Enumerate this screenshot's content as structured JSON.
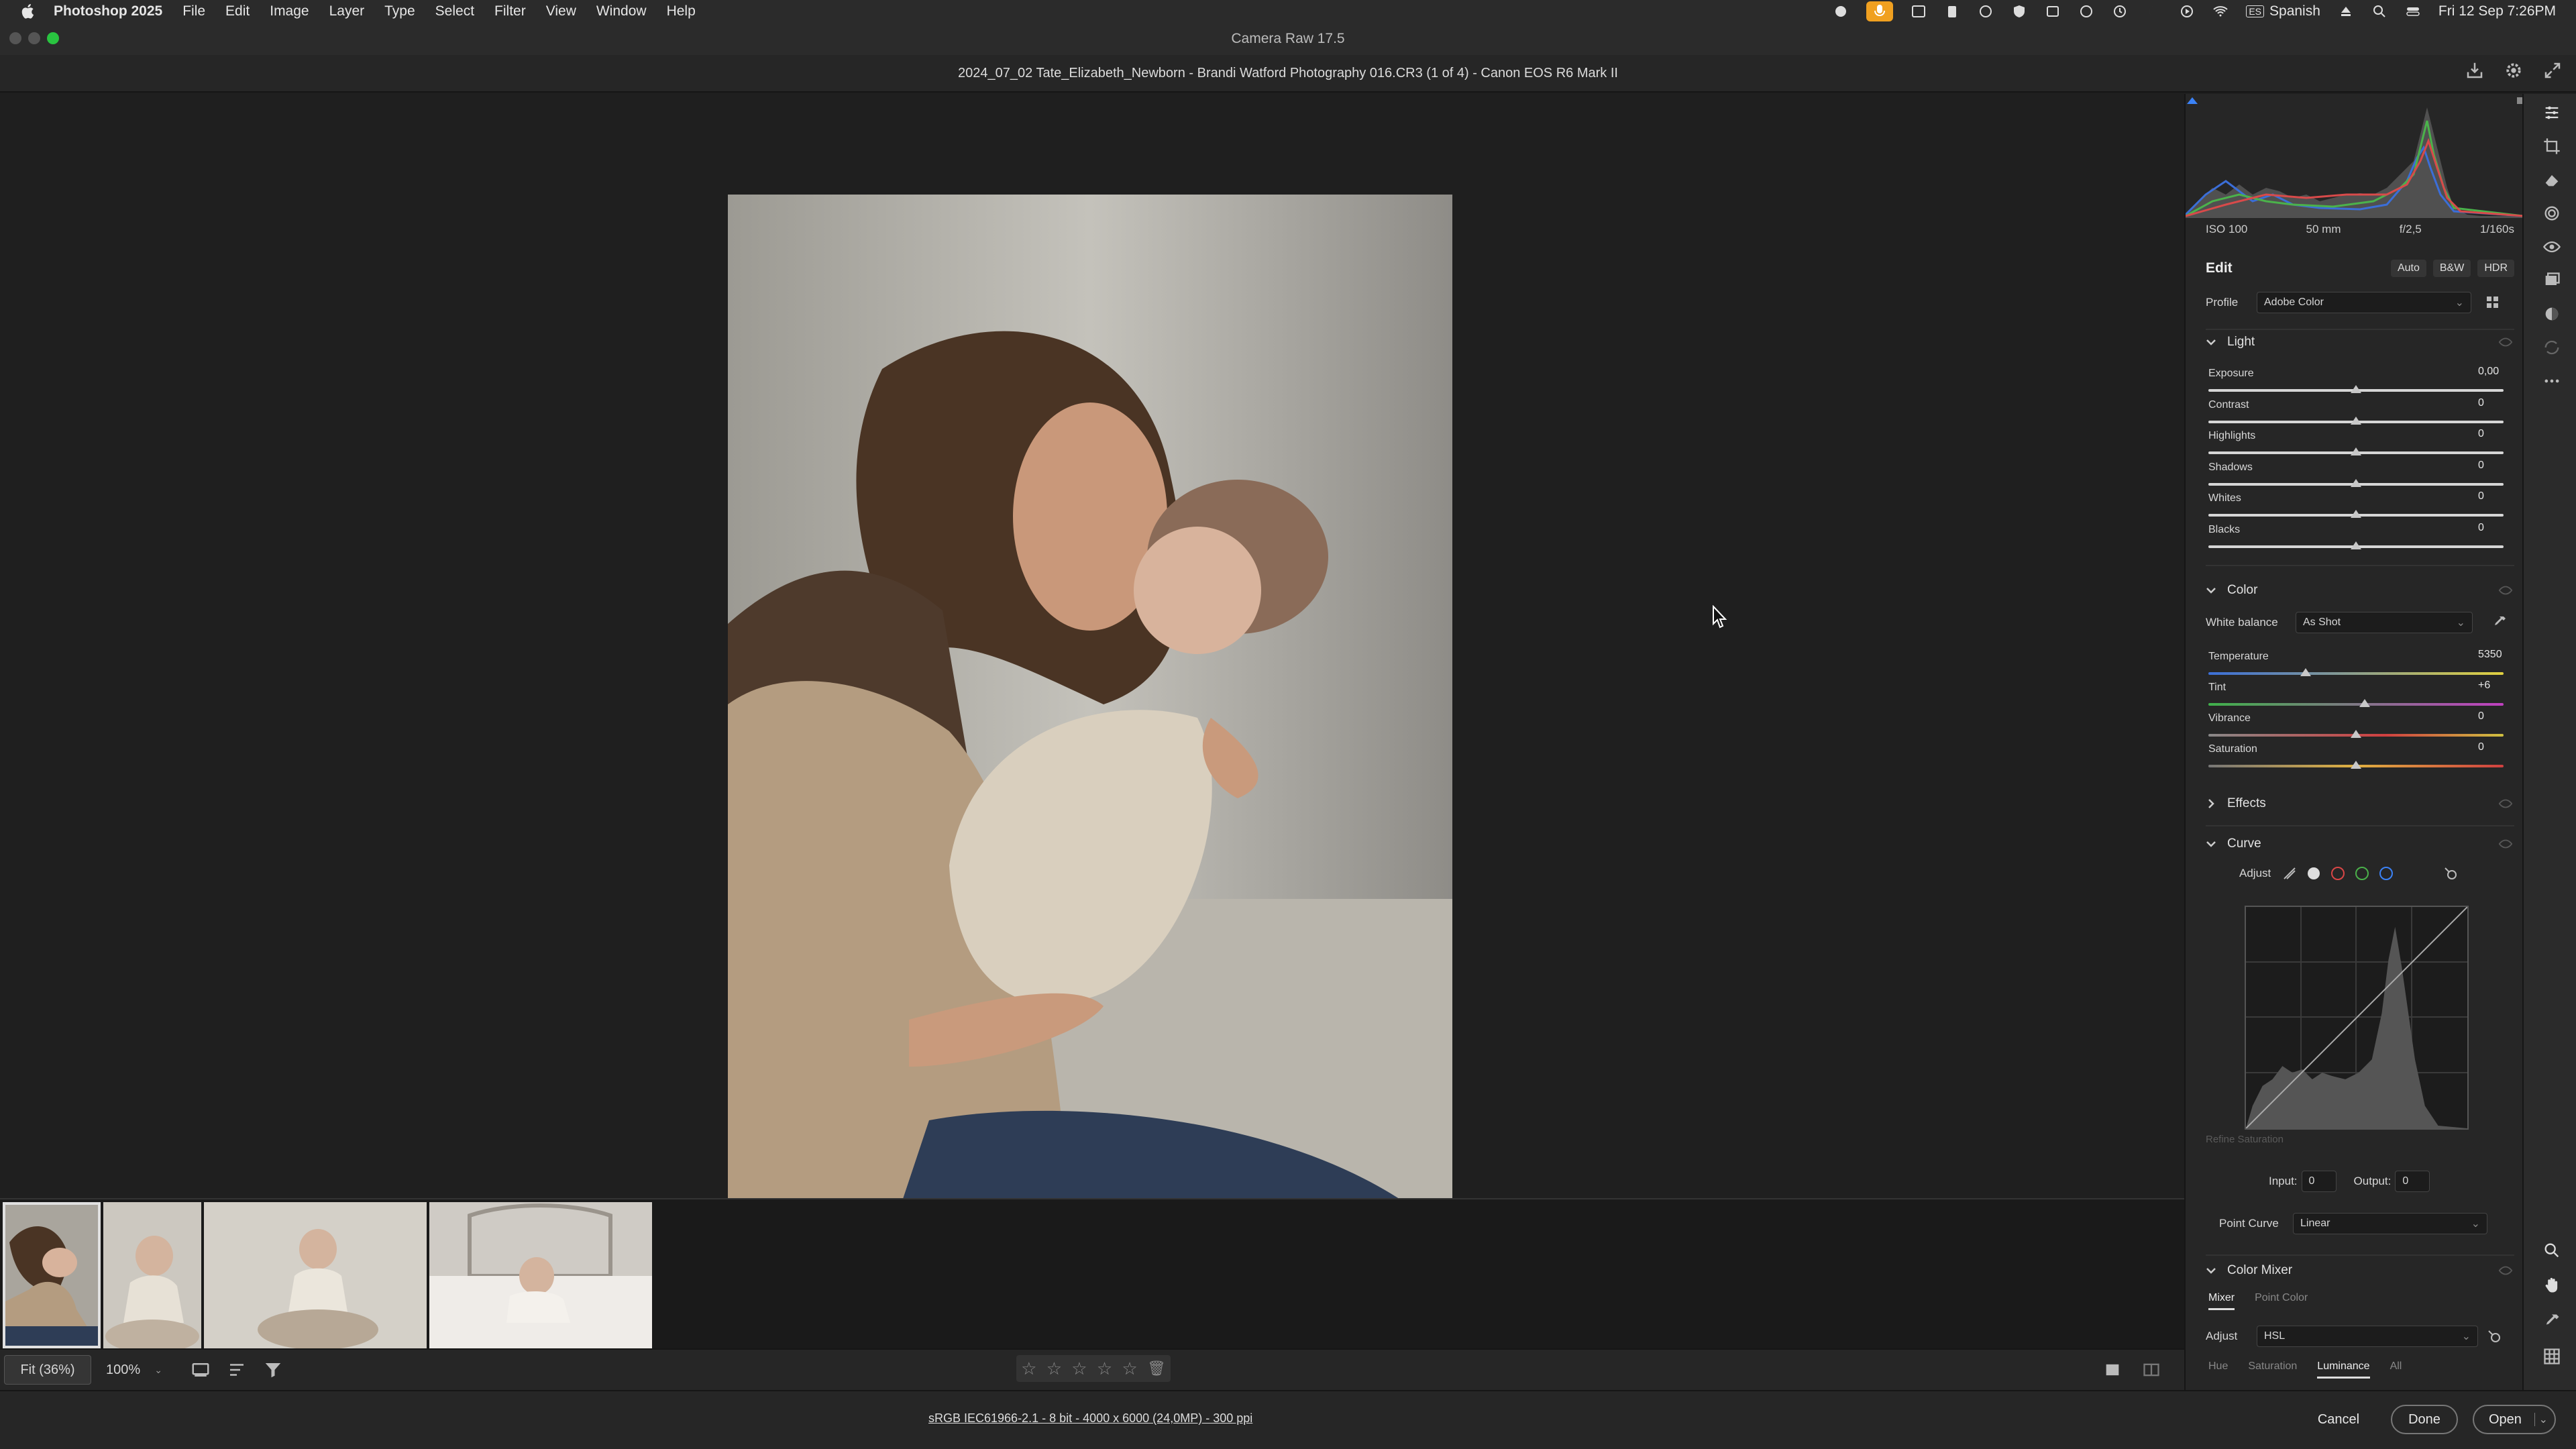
{
  "menubar": {
    "app_name": "Photoshop 2025",
    "items": [
      "File",
      "Edit",
      "Image",
      "Layer",
      "Type",
      "Select",
      "Filter",
      "View",
      "Window",
      "Help"
    ],
    "input_source": "Spanish",
    "datetime": "Fri 12 Sep  7:26PM"
  },
  "window": {
    "title": "Camera Raw 17.5",
    "document": "2024_07_02 Tate_Elizabeth_Newborn - Brandi Watford Photography 016.CR3 (1 of 4)  -  Canon EOS R6 Mark II"
  },
  "exif": {
    "iso": "ISO 100",
    "focal": "50 mm",
    "aperture": "f/2,5",
    "shutter": "1/160s"
  },
  "edit": {
    "title": "Edit",
    "auto": "Auto",
    "bw": "B&W",
    "hdr": "HDR",
    "profile_label": "Profile",
    "profile_value": "Adobe Color"
  },
  "light": {
    "title": "Light",
    "sliders": [
      {
        "label": "Exposure",
        "value": "0,00",
        "pos": 0.5
      },
      {
        "label": "Contrast",
        "value": "0",
        "pos": 0.5
      },
      {
        "label": "Highlights",
        "value": "0",
        "pos": 0.5
      },
      {
        "label": "Shadows",
        "value": "0",
        "pos": 0.5
      },
      {
        "label": "Whites",
        "value": "0",
        "pos": 0.5
      },
      {
        "label": "Blacks",
        "value": "0",
        "pos": 0.5
      }
    ]
  },
  "color": {
    "title": "Color",
    "wb_label": "White balance",
    "wb_value": "As Shot",
    "sliders": [
      {
        "label": "Temperature",
        "value": "5350",
        "pos": 0.33
      },
      {
        "label": "Tint",
        "value": "+6",
        "pos": 0.53
      },
      {
        "label": "Vibrance",
        "value": "0",
        "pos": 0.5
      },
      {
        "label": "Saturation",
        "value": "0",
        "pos": 0.5
      }
    ]
  },
  "effects": {
    "title": "Effects"
  },
  "curve": {
    "title": "Curve",
    "adjust_label": "Adjust",
    "refine": "Refine Saturation",
    "input_label": "Input:",
    "input_value": "0",
    "output_label": "Output:",
    "output_value": "0",
    "point_curve_label": "Point Curve",
    "point_curve_value": "Linear"
  },
  "mixer": {
    "title": "Color Mixer",
    "tab_mixer": "Mixer",
    "tab_point": "Point Color",
    "adjust_label": "Adjust",
    "adjust_value": "HSL",
    "subtabs": [
      "Hue",
      "Saturation",
      "Luminance",
      "All"
    ],
    "active_subtab": "Luminance"
  },
  "bottom": {
    "fit": "Fit (36%)",
    "zoom": "100%",
    "image_info": "sRGB IEC61966-2.1 - 8 bit - 4000 x 6000 (24,0MP) - 300 ppi",
    "cancel": "Cancel",
    "done": "Done",
    "open": "Open"
  }
}
